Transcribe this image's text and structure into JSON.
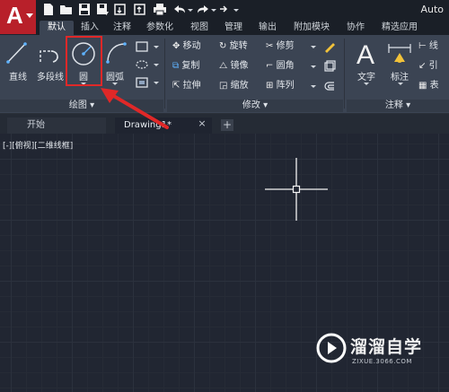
{
  "app": {
    "title": "Auto",
    "logo_letter": "A"
  },
  "quick_access": [
    "new-icon",
    "open-icon",
    "save-icon",
    "save-as-icon",
    "cloud-open-icon",
    "cloud-save-icon",
    "print-icon",
    "undo-icon",
    "redo-icon",
    "share-icon"
  ],
  "ribbon_tabs": [
    {
      "label": "默认",
      "active": true
    },
    {
      "label": "插入"
    },
    {
      "label": "注释"
    },
    {
      "label": "参数化"
    },
    {
      "label": "视图"
    },
    {
      "label": "管理"
    },
    {
      "label": "输出"
    },
    {
      "label": "附加模块"
    },
    {
      "label": "协作"
    },
    {
      "label": "精选应用"
    }
  ],
  "draw_panel": {
    "title": "绘图",
    "line": "直线",
    "polyline": "多段线",
    "circle": "圆",
    "arc": "圆弧"
  },
  "modify_panel": {
    "title": "修改",
    "move": "移动",
    "rotate": "旋转",
    "trim": "修剪",
    "copy": "复制",
    "mirror": "镜像",
    "fillet": "圆角",
    "stretch": "拉伸",
    "scale": "缩放",
    "array": "阵列"
  },
  "annotation_panel": {
    "title": "注释",
    "text": "文字",
    "dimension": "标注",
    "linear": "线",
    "leader": "引",
    "table": "表"
  },
  "file_tabs": {
    "start": "开始",
    "drawing": "Drawing1*",
    "close": "×",
    "add": "+"
  },
  "viewport_label": "[-][俯视][二维线框]",
  "watermark": {
    "name": "溜溜自学",
    "url": "ZIXUE.3066.COM"
  },
  "colors": {
    "highlight": "#e02828",
    "ribbon": "#3b4453",
    "canvas": "#212632",
    "logo": "#b8202a"
  }
}
